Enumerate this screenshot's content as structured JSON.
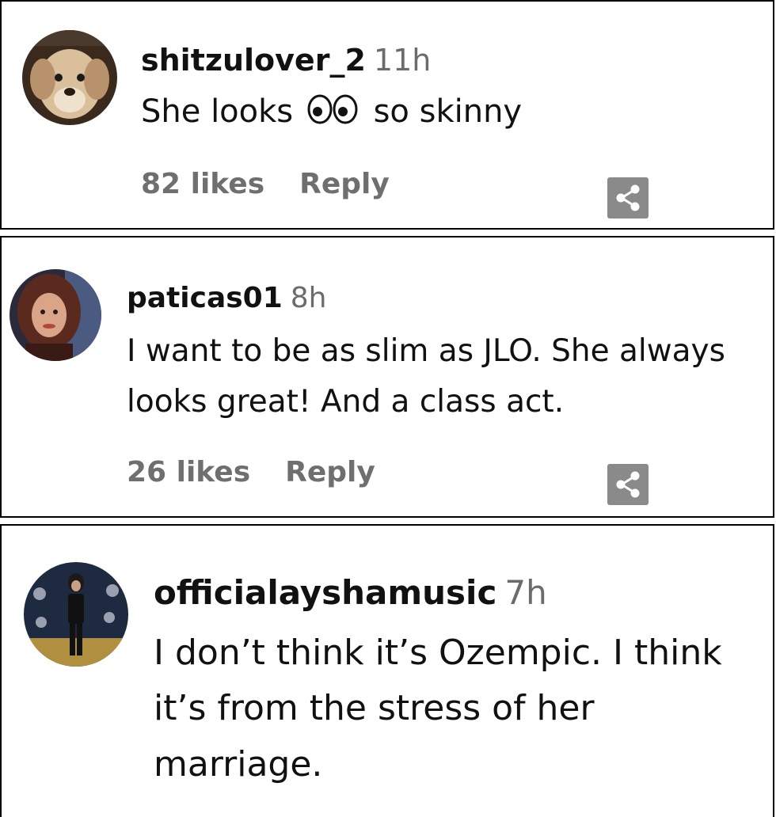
{
  "comments": [
    {
      "username": "shitzulover_2",
      "time": "11h",
      "text_before": "She looks",
      "emoji": "eyes-icon",
      "text_after": "so skinny",
      "likes": "82 likes",
      "reply": "Reply"
    },
    {
      "username": "paticas01",
      "time": "8h",
      "text": "I want to be as slim as JLO. She always looks great! And a class act.",
      "likes": "26 likes",
      "reply": "Reply"
    },
    {
      "username": "officialayshamusic",
      "time": "7h",
      "text": "I don’t think it’s Ozempic. I think it’s from the stress of her marriage."
    }
  ],
  "colors": {
    "meta_text": "#6f6f6f",
    "share_button": "#8a8a8a"
  }
}
